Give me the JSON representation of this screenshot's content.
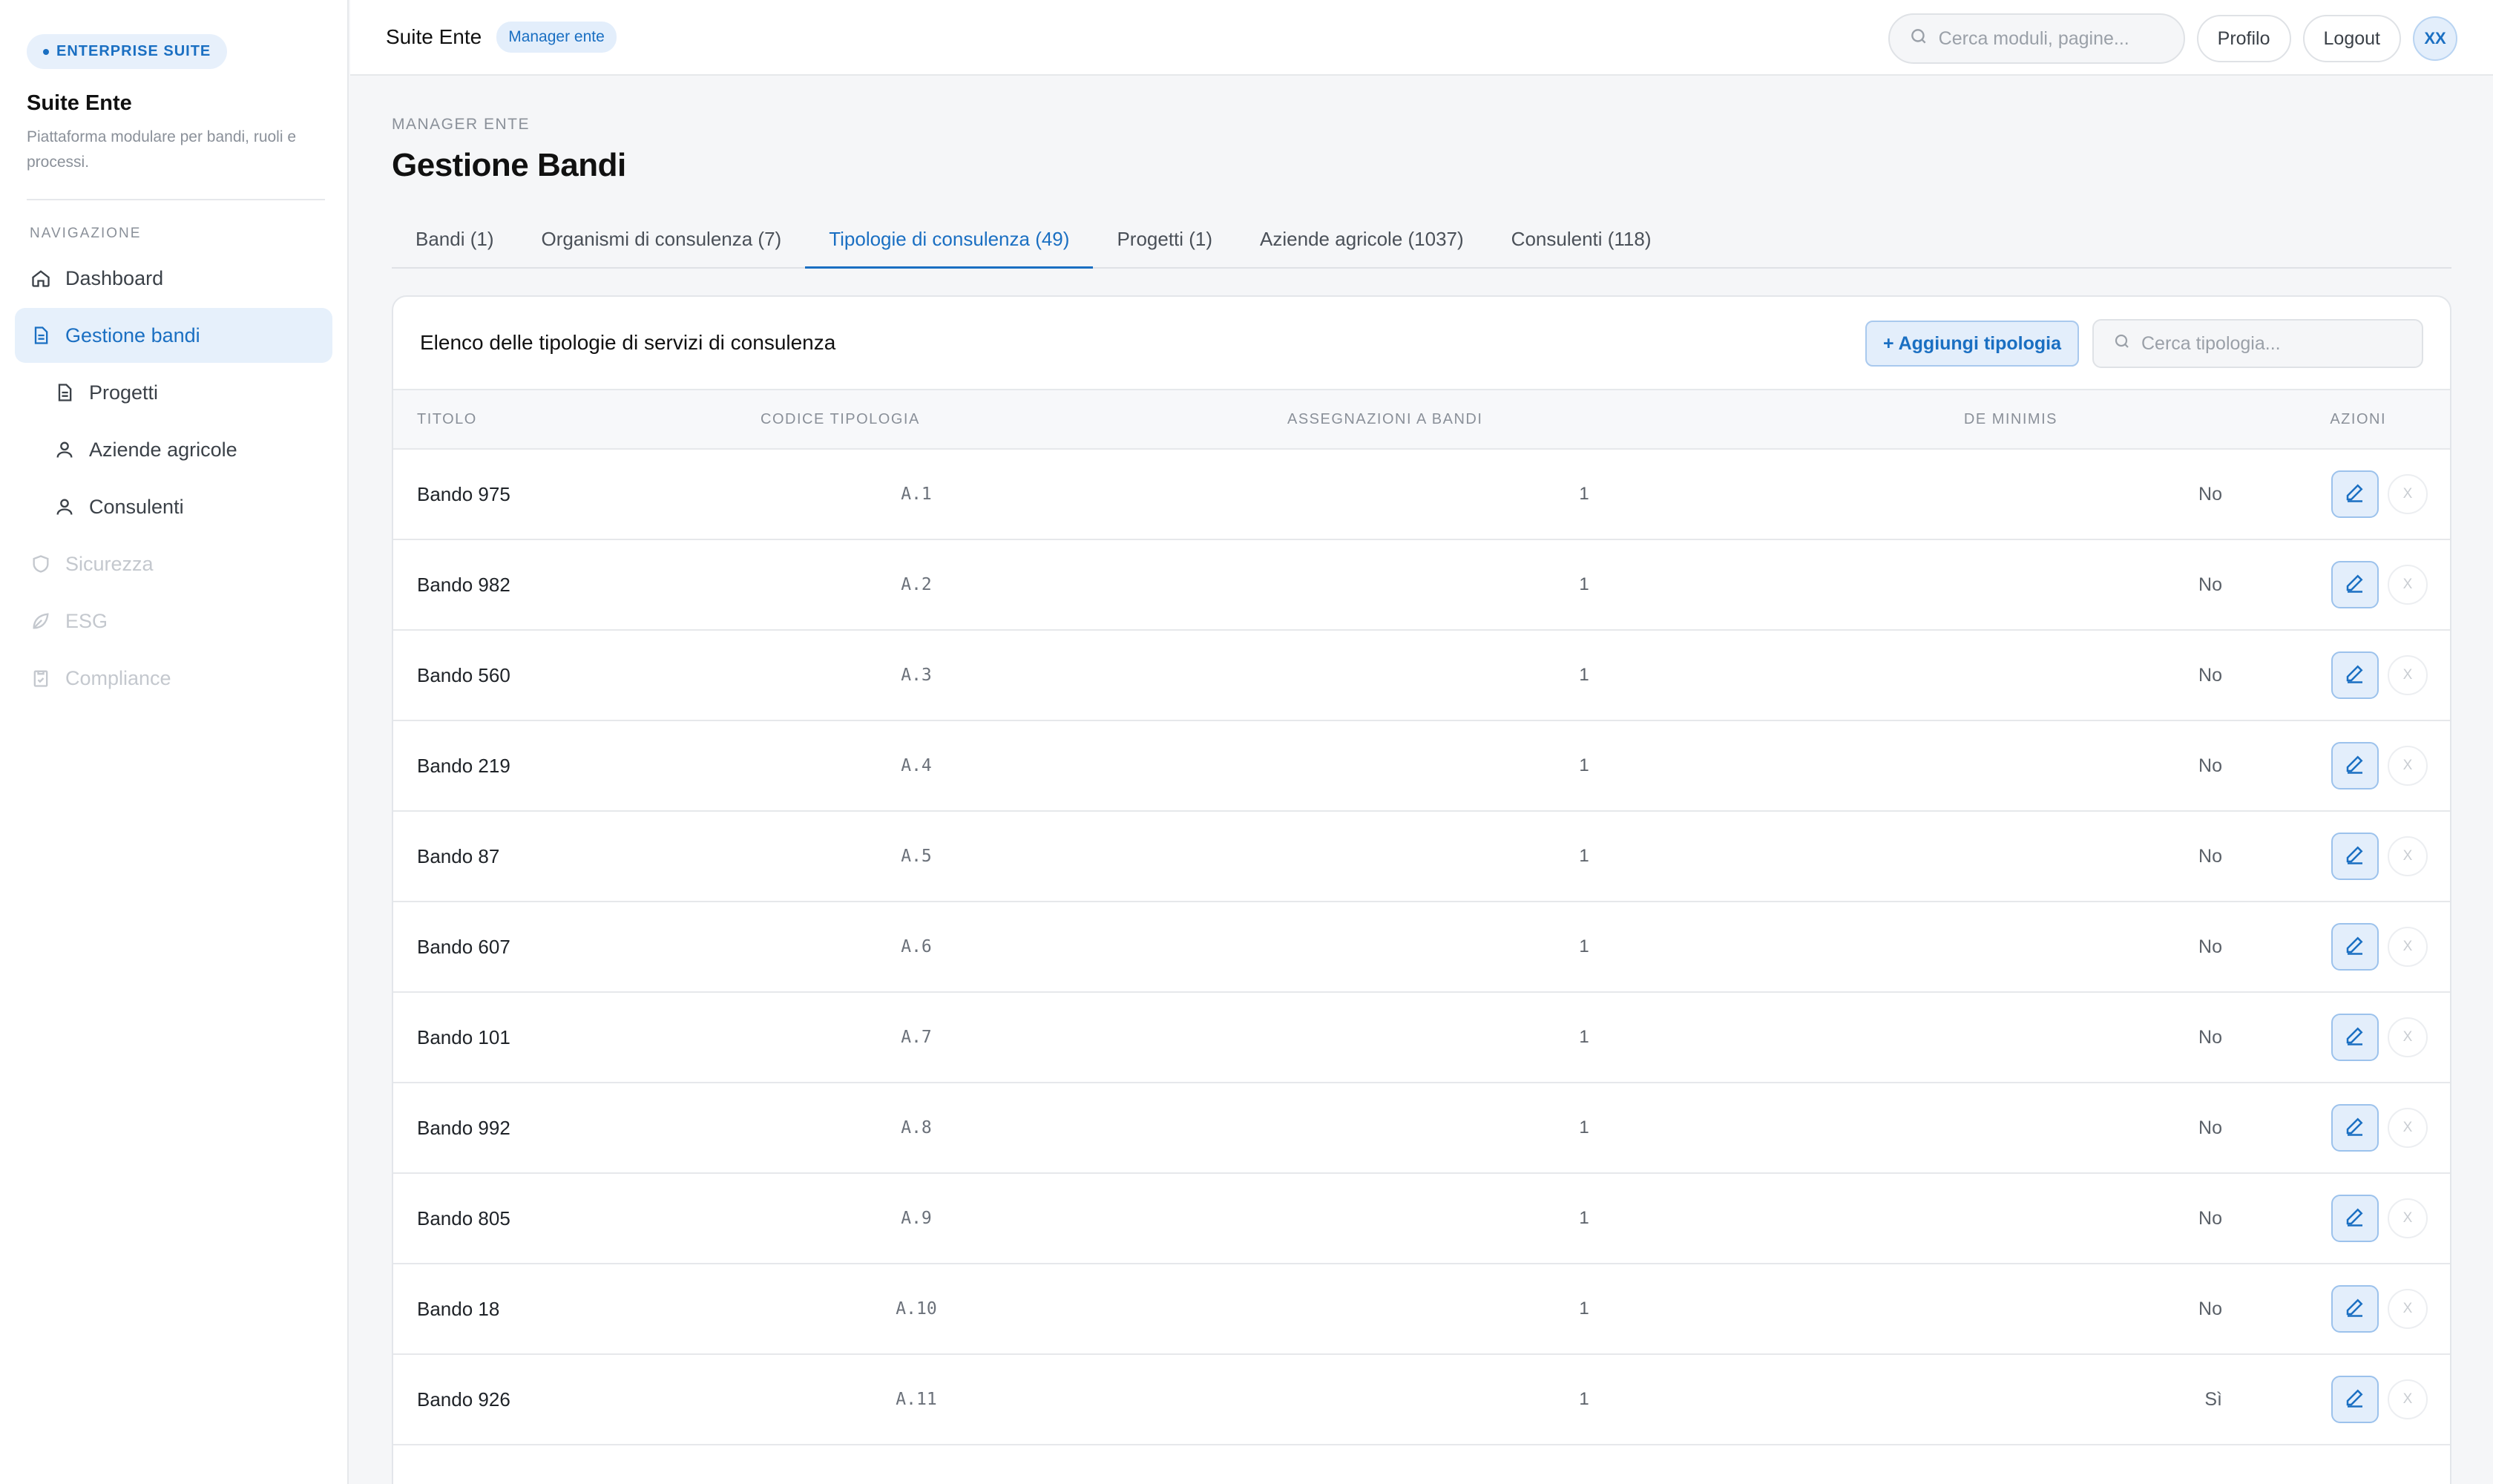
{
  "sidebar": {
    "brand_badge": "ENTERPRISE SUITE",
    "title": "Suite Ente",
    "subtitle": "Piattaforma modulare per bandi, ruoli e processi.",
    "nav_heading": "NAVIGAZIONE",
    "items": [
      {
        "label": "Dashboard",
        "icon": "home-icon"
      },
      {
        "label": "Gestione bandi",
        "icon": "document-icon"
      },
      {
        "label": "Progetti",
        "icon": "document-icon"
      },
      {
        "label": "Aziende agricole",
        "icon": "user-icon"
      },
      {
        "label": "Consulenti",
        "icon": "user-icon"
      },
      {
        "label": "Sicurezza",
        "icon": "shield-icon"
      },
      {
        "label": "ESG",
        "icon": "leaf-icon"
      },
      {
        "label": "Compliance",
        "icon": "clipboard-icon"
      }
    ]
  },
  "topbar": {
    "title": "Suite Ente",
    "role": "Manager ente",
    "search_placeholder": "Cerca moduli, pagine...",
    "profile_label": "Profilo",
    "logout_label": "Logout",
    "avatar": "XX"
  },
  "main": {
    "breadcrumb": "MANAGER ENTE",
    "title": "Gestione Bandi",
    "tabs": [
      {
        "label": "Bandi (1)"
      },
      {
        "label": "Organismi di consulenza (7)"
      },
      {
        "label": "Tipologie di consulenza (49)"
      },
      {
        "label": "Progetti (1)"
      },
      {
        "label": "Aziende agricole (1037)"
      },
      {
        "label": "Consulenti (118)"
      }
    ],
    "active_tab": "Tipologie di consulenza (49)",
    "card": {
      "title": "Elenco delle tipologie di servizi di consulenza",
      "add_label": "+ Aggiungi tipologia",
      "search_placeholder": "Cerca tipologia..."
    },
    "table": {
      "headers": [
        "TITOLO",
        "CODICE TIPOLOGIA",
        "ASSEGNAZIONI A BANDI",
        "DE MINIMIS",
        "AZIONI"
      ],
      "delete_label": "X",
      "rows": [
        {
          "title": "Bando 975",
          "code": "A.1",
          "assign": "1",
          "deminimis": "No"
        },
        {
          "title": "Bando 982",
          "code": "A.2",
          "assign": "1",
          "deminimis": "No"
        },
        {
          "title": "Bando 560",
          "code": "A.3",
          "assign": "1",
          "deminimis": "No"
        },
        {
          "title": "Bando 219",
          "code": "A.4",
          "assign": "1",
          "deminimis": "No"
        },
        {
          "title": "Bando 87",
          "code": "A.5",
          "assign": "1",
          "deminimis": "No"
        },
        {
          "title": "Bando 607",
          "code": "A.6",
          "assign": "1",
          "deminimis": "No"
        },
        {
          "title": "Bando 101",
          "code": "A.7",
          "assign": "1",
          "deminimis": "No"
        },
        {
          "title": "Bando 992",
          "code": "A.8",
          "assign": "1",
          "deminimis": "No"
        },
        {
          "title": "Bando 805",
          "code": "A.9",
          "assign": "1",
          "deminimis": "No"
        },
        {
          "title": "Bando 18",
          "code": "A.10",
          "assign": "1",
          "deminimis": "No"
        },
        {
          "title": "Bando 926",
          "code": "A.11",
          "assign": "1",
          "deminimis": "Sì"
        }
      ]
    }
  },
  "colors": {
    "accent": "#1a6fc2",
    "accent_bg": "#e3eefb"
  }
}
